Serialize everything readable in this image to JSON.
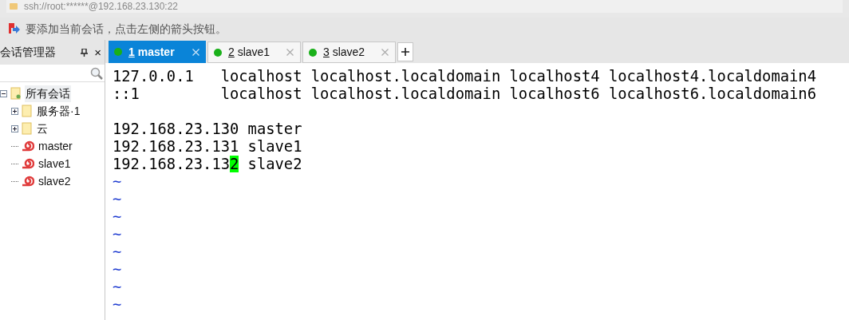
{
  "address_bar": {
    "text": "ssh://root:******@192.168.23.130:22"
  },
  "info_bar": {
    "text": "要添加当前会话，点击左侧的箭头按钮。"
  },
  "session_manager": {
    "title": "会话管理器",
    "close": "×",
    "tree": [
      {
        "label": "所有会话",
        "kind": "root",
        "expanded": true,
        "selected": true,
        "children": [
          {
            "label": "服务器·1",
            "kind": "folder",
            "expanded": false,
            "selected": false
          },
          {
            "label": "云",
            "kind": "folder",
            "expanded": false,
            "selected": false
          },
          {
            "label": "master",
            "kind": "session",
            "selected": false
          },
          {
            "label": "slave1",
            "kind": "session",
            "selected": false
          },
          {
            "label": "slave2",
            "kind": "session",
            "selected": false
          }
        ]
      }
    ]
  },
  "tabs": [
    {
      "number": "1",
      "label": "master",
      "selected": true,
      "color": "#1ab01a"
    },
    {
      "number": "2",
      "label": "slave1",
      "selected": false,
      "color": "#1ab01a"
    },
    {
      "number": "3",
      "label": "slave2",
      "selected": false,
      "color": "#1ab01a"
    }
  ],
  "terminal": {
    "lines": [
      {
        "kind": "text",
        "text": "127.0.0.1   localhost localhost.localdomain localhost4 localhost4.localdomain4"
      },
      {
        "kind": "text",
        "text": "::1         localhost localhost.localdomain localhost6 localhost6.localdomain6"
      },
      {
        "kind": "blank"
      },
      {
        "kind": "text",
        "text": "192.168.23.130 master"
      },
      {
        "kind": "text",
        "text": "192.168.23.131 slave1"
      },
      {
        "kind": "cursor",
        "before": "192.168.23.13",
        "cursor": "2",
        "after": " slave2"
      },
      {
        "kind": "tilde",
        "text": "~"
      },
      {
        "kind": "tilde",
        "text": "~"
      },
      {
        "kind": "tilde",
        "text": "~"
      },
      {
        "kind": "tilde",
        "text": "~"
      },
      {
        "kind": "tilde",
        "text": "~"
      },
      {
        "kind": "tilde",
        "text": "~"
      },
      {
        "kind": "tilde",
        "text": "~"
      },
      {
        "kind": "tilde",
        "text": "~"
      }
    ]
  }
}
